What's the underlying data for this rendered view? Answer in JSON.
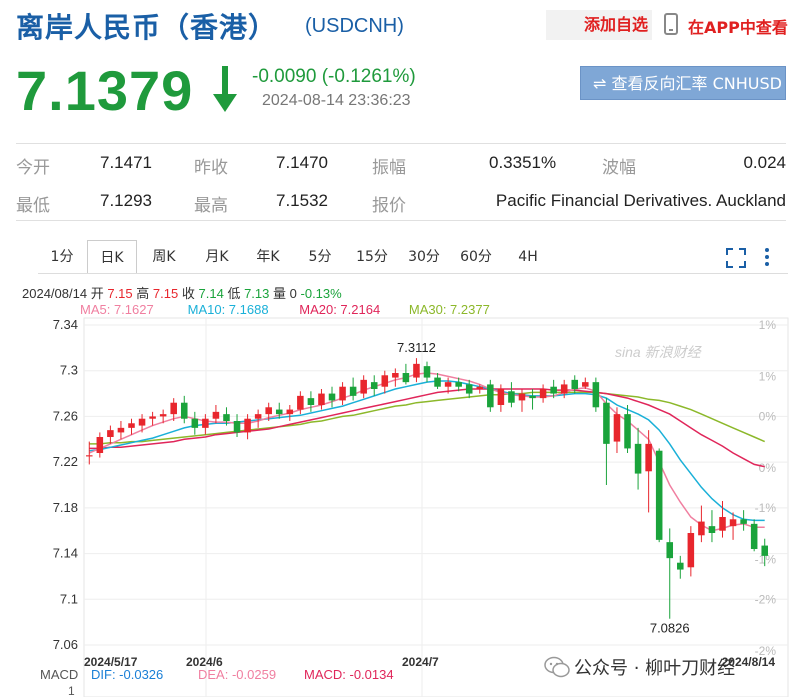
{
  "header": {
    "title": "离岸人民币（香港）",
    "code": "(USDCNH)",
    "add_fav": "添加自选",
    "app_view": "在APP中查看"
  },
  "quote": {
    "price": "7.1379",
    "change": "-0.0090 (-0.1261%)",
    "timestamp": "2024-08-14 23:36:23",
    "reverse_btn": "⇌ 查看反向汇率 CNHUSD",
    "direction": "down"
  },
  "stats": [
    {
      "label": "今开",
      "value": "7.1471"
    },
    {
      "label": "昨收",
      "value": "7.1470"
    },
    {
      "label": "振幅",
      "value": "0.3351%"
    },
    {
      "label": "波幅",
      "value": "0.024"
    },
    {
      "label": "最低",
      "value": "7.1293"
    },
    {
      "label": "最高",
      "value": "7.1532"
    },
    {
      "label": "报价",
      "value": "Pacific Financial Derivatives. Auckland"
    }
  ],
  "tabs": [
    "1分",
    "日K",
    "周K",
    "月K",
    "年K",
    "5分",
    "15分",
    "30分",
    "60分",
    "4H"
  ],
  "active_tab": "日K",
  "info": {
    "date": "2024/08/14",
    "open_label": "开",
    "open": "7.15",
    "high_label": "高",
    "high": "7.15",
    "close_label": "收",
    "close": "7.14",
    "low_label": "低",
    "low": "7.13",
    "vol_label": "量",
    "vol": "0",
    "pct": "-0.13%",
    "ma5": "MA5: 7.1627",
    "ma10": "MA10: 7.1688",
    "ma20": "MA20: 7.2164",
    "ma30": "MA30: 7.2377"
  },
  "colors": {
    "up": "#e8262d",
    "down": "#1aa33b",
    "ma5": "#f07fa0",
    "ma10": "#1ab0d8",
    "ma20": "#e0265a",
    "ma30": "#8cb82a",
    "title": "#1a5fa6"
  },
  "watermark": "sina 新浪财经",
  "macd": {
    "label": "MACD",
    "dif": "DIF: -0.0326",
    "dea": "DEA: -0.0259",
    "macd": "MACD: -0.0134",
    "axis_top": "1"
  },
  "footer": "公众号 · 柳叶刀财经",
  "chart_data": {
    "type": "candlestick",
    "ylim": [
      7.06,
      7.34
    ],
    "y_ticks": [
      "7.34",
      "7.3",
      "7.26",
      "7.22",
      "7.18",
      "7.14",
      "7.1",
      "7.06"
    ],
    "right_ticks": [
      "1%",
      "1%",
      "0%",
      "0%",
      "-1%",
      "-1%",
      "-2%",
      "-2%"
    ],
    "x_labels": [
      "2024/5/17",
      "2024/6",
      "2024/7",
      "2024/8/14"
    ],
    "max_label": "7.3112",
    "min_label": "7.0826",
    "candles": [
      [
        7.225,
        7.238,
        7.218,
        7.226
      ],
      [
        7.228,
        7.246,
        7.224,
        7.242
      ],
      [
        7.242,
        7.252,
        7.236,
        7.248
      ],
      [
        7.246,
        7.256,
        7.24,
        7.25
      ],
      [
        7.25,
        7.258,
        7.244,
        7.254
      ],
      [
        7.252,
        7.262,
        7.246,
        7.258
      ],
      [
        7.258,
        7.264,
        7.252,
        7.26
      ],
      [
        7.26,
        7.266,
        7.254,
        7.262
      ],
      [
        7.262,
        7.276,
        7.256,
        7.272
      ],
      [
        7.272,
        7.278,
        7.254,
        7.258
      ],
      [
        7.258,
        7.264,
        7.244,
        7.25
      ],
      [
        7.25,
        7.262,
        7.244,
        7.258
      ],
      [
        7.258,
        7.27,
        7.254,
        7.264
      ],
      [
        7.262,
        7.268,
        7.252,
        7.256
      ],
      [
        7.256,
        7.262,
        7.242,
        7.246
      ],
      [
        7.246,
        7.262,
        7.24,
        7.258
      ],
      [
        7.258,
        7.266,
        7.25,
        7.262
      ],
      [
        7.262,
        7.272,
        7.256,
        7.268
      ],
      [
        7.266,
        7.272,
        7.258,
        7.262
      ],
      [
        7.262,
        7.27,
        7.256,
        7.266
      ],
      [
        7.266,
        7.282,
        7.262,
        7.278
      ],
      [
        7.276,
        7.282,
        7.264,
        7.27
      ],
      [
        7.27,
        7.284,
        7.266,
        7.28
      ],
      [
        7.28,
        7.286,
        7.268,
        7.274
      ],
      [
        7.274,
        7.29,
        7.27,
        7.286
      ],
      [
        7.286,
        7.294,
        7.274,
        7.278
      ],
      [
        7.28,
        7.296,
        7.276,
        7.292
      ],
      [
        7.29,
        7.296,
        7.278,
        7.284
      ],
      [
        7.286,
        7.3,
        7.28,
        7.296
      ],
      [
        7.294,
        7.302,
        7.286,
        7.298
      ],
      [
        7.298,
        7.306,
        7.288,
        7.29
      ],
      [
        7.294,
        7.311,
        7.29,
        7.306
      ],
      [
        7.304,
        7.308,
        7.29,
        7.294
      ],
      [
        7.294,
        7.298,
        7.284,
        7.286
      ],
      [
        7.286,
        7.294,
        7.28,
        7.29
      ],
      [
        7.29,
        7.294,
        7.282,
        7.286
      ],
      [
        7.288,
        7.292,
        7.276,
        7.28
      ],
      [
        7.284,
        7.288,
        7.28,
        7.286
      ],
      [
        7.288,
        7.292,
        7.264,
        7.268
      ],
      [
        7.27,
        7.288,
        7.264,
        7.284
      ],
      [
        7.282,
        7.29,
        7.268,
        7.272
      ],
      [
        7.274,
        7.284,
        7.264,
        7.28
      ],
      [
        7.278,
        7.284,
        7.266,
        7.276
      ],
      [
        7.276,
        7.288,
        7.272,
        7.284
      ],
      [
        7.286,
        7.292,
        7.276,
        7.28
      ],
      [
        7.28,
        7.292,
        7.276,
        7.288
      ],
      [
        7.292,
        7.296,
        7.28,
        7.284
      ],
      [
        7.286,
        7.294,
        7.284,
        7.29
      ],
      [
        7.29,
        7.294,
        7.264,
        7.268
      ],
      [
        7.272,
        7.276,
        7.2,
        7.236
      ],
      [
        7.238,
        7.268,
        7.228,
        7.262
      ],
      [
        7.262,
        7.27,
        7.228,
        7.232
      ],
      [
        7.236,
        7.25,
        7.196,
        7.21
      ],
      [
        7.212,
        7.248,
        7.176,
        7.236
      ],
      [
        7.23,
        7.232,
        7.15,
        7.152
      ],
      [
        7.15,
        7.162,
        7.083,
        7.136
      ],
      [
        7.132,
        7.138,
        7.118,
        7.126
      ],
      [
        7.128,
        7.164,
        7.12,
        7.158
      ],
      [
        7.156,
        7.182,
        7.15,
        7.168
      ],
      [
        7.164,
        7.178,
        7.15,
        7.158
      ],
      [
        7.16,
        7.186,
        7.154,
        7.172
      ],
      [
        7.164,
        7.176,
        7.152,
        7.17
      ],
      [
        7.17,
        7.178,
        7.16,
        7.166
      ],
      [
        7.166,
        7.17,
        7.142,
        7.144
      ],
      [
        7.147,
        7.153,
        7.129,
        7.138
      ]
    ],
    "ma5": [
      7.228,
      7.232,
      7.236,
      7.24,
      7.244,
      7.248,
      7.252,
      7.255,
      7.258,
      7.26,
      7.258,
      7.256,
      7.255,
      7.255,
      7.254,
      7.254,
      7.256,
      7.259,
      7.261,
      7.263,
      7.266,
      7.268,
      7.27,
      7.273,
      7.276,
      7.279,
      7.283,
      7.286,
      7.289,
      7.292,
      7.294,
      7.297,
      7.298,
      7.297,
      7.295,
      7.293,
      7.291,
      7.288,
      7.284,
      7.281,
      7.279,
      7.278,
      7.277,
      7.277,
      7.278,
      7.281,
      7.284,
      7.285,
      7.282,
      7.271,
      7.262,
      7.256,
      7.248,
      7.24,
      7.22,
      7.2,
      7.185,
      7.172,
      7.165,
      7.16,
      7.162,
      7.165,
      7.166,
      7.163,
      7.163
    ],
    "ma10": [
      7.23,
      7.231,
      7.233,
      7.235,
      7.237,
      7.239,
      7.241,
      7.244,
      7.247,
      7.25,
      7.252,
      7.253,
      7.254,
      7.254,
      7.255,
      7.256,
      7.257,
      7.258,
      7.259,
      7.26,
      7.261,
      7.263,
      7.265,
      7.267,
      7.269,
      7.272,
      7.275,
      7.278,
      7.281,
      7.284,
      7.286,
      7.288,
      7.29,
      7.291,
      7.291,
      7.29,
      7.288,
      7.286,
      7.284,
      7.282,
      7.28,
      7.279,
      7.278,
      7.278,
      7.278,
      7.279,
      7.28,
      7.28,
      7.279,
      7.276,
      7.27,
      7.266,
      7.262,
      7.257,
      7.248,
      7.236,
      7.222,
      7.21,
      7.198,
      7.188,
      7.18,
      7.174,
      7.17,
      7.169,
      7.169
    ],
    "ma20": [
      7.232,
      7.232,
      7.233,
      7.233,
      7.234,
      7.235,
      7.236,
      7.237,
      7.238,
      7.24,
      7.241,
      7.242,
      7.244,
      7.245,
      7.246,
      7.247,
      7.248,
      7.249,
      7.251,
      7.253,
      7.255,
      7.257,
      7.259,
      7.261,
      7.263,
      7.265,
      7.267,
      7.269,
      7.271,
      7.273,
      7.275,
      7.277,
      7.279,
      7.281,
      7.282,
      7.283,
      7.284,
      7.284,
      7.284,
      7.284,
      7.284,
      7.284,
      7.284,
      7.284,
      7.283,
      7.283,
      7.283,
      7.282,
      7.281,
      7.28,
      7.278,
      7.276,
      7.273,
      7.27,
      7.266,
      7.262,
      7.256,
      7.25,
      7.244,
      7.239,
      7.234,
      7.228,
      7.223,
      7.218,
      7.216
    ],
    "ma30": [
      7.236,
      7.236,
      7.237,
      7.237,
      7.238,
      7.238,
      7.239,
      7.24,
      7.241,
      7.242,
      7.243,
      7.244,
      7.245,
      7.246,
      7.247,
      7.248,
      7.249,
      7.25,
      7.251,
      7.252,
      7.253,
      7.255,
      7.256,
      7.258,
      7.26,
      7.261,
      7.263,
      7.265,
      7.267,
      7.269,
      7.27,
      7.272,
      7.273,
      7.274,
      7.275,
      7.276,
      7.277,
      7.278,
      7.279,
      7.279,
      7.28,
      7.28,
      7.281,
      7.281,
      7.281,
      7.281,
      7.281,
      7.281,
      7.281,
      7.28,
      7.279,
      7.278,
      7.277,
      7.275,
      7.274,
      7.272,
      7.269,
      7.266,
      7.262,
      7.258,
      7.254,
      7.25,
      7.246,
      7.242,
      7.238
    ]
  }
}
